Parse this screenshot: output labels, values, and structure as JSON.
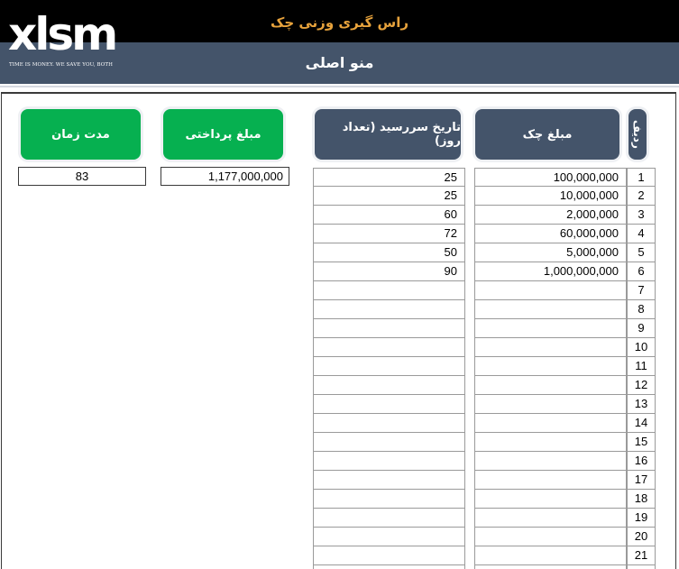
{
  "header": {
    "app_title": "راس گیری وزنی چک",
    "menu_title": "منو اصلی",
    "title_color": "#e8a33c",
    "bar_color": "#44546a"
  },
  "logo": {
    "text": "xlsm",
    "tagline": "TIME IS MONEY. WE SAVE YOU, BOTH"
  },
  "results": {
    "duration_label": "مدت زمان",
    "duration_value": "83",
    "payment_label": "مبلغ پرداختی",
    "payment_value": "1,177,000,000"
  },
  "table": {
    "col_row_label": "ردیف",
    "col_amount_label": "مبلغ چک",
    "col_due_label": "تاریخ سررسید (تعداد روز)",
    "rows": [
      {
        "n": "1",
        "amount": "100,000,000",
        "due": "25"
      },
      {
        "n": "2",
        "amount": "10,000,000",
        "due": "25"
      },
      {
        "n": "3",
        "amount": "2,000,000",
        "due": "60"
      },
      {
        "n": "4",
        "amount": "60,000,000",
        "due": "72"
      },
      {
        "n": "5",
        "amount": "5,000,000",
        "due": "50"
      },
      {
        "n": "6",
        "amount": "1,000,000,000",
        "due": "90"
      },
      {
        "n": "7",
        "amount": "",
        "due": ""
      },
      {
        "n": "8",
        "amount": "",
        "due": ""
      },
      {
        "n": "9",
        "amount": "",
        "due": ""
      },
      {
        "n": "10",
        "amount": "",
        "due": ""
      },
      {
        "n": "11",
        "amount": "",
        "due": ""
      },
      {
        "n": "12",
        "amount": "",
        "due": ""
      },
      {
        "n": "13",
        "amount": "",
        "due": ""
      },
      {
        "n": "14",
        "amount": "",
        "due": ""
      },
      {
        "n": "15",
        "amount": "",
        "due": ""
      },
      {
        "n": "16",
        "amount": "",
        "due": ""
      },
      {
        "n": "17",
        "amount": "",
        "due": ""
      },
      {
        "n": "18",
        "amount": "",
        "due": ""
      },
      {
        "n": "19",
        "amount": "",
        "due": ""
      },
      {
        "n": "20",
        "amount": "",
        "due": ""
      },
      {
        "n": "21",
        "amount": "",
        "due": ""
      },
      {
        "n": "",
        "amount": "",
        "due": ""
      }
    ]
  }
}
